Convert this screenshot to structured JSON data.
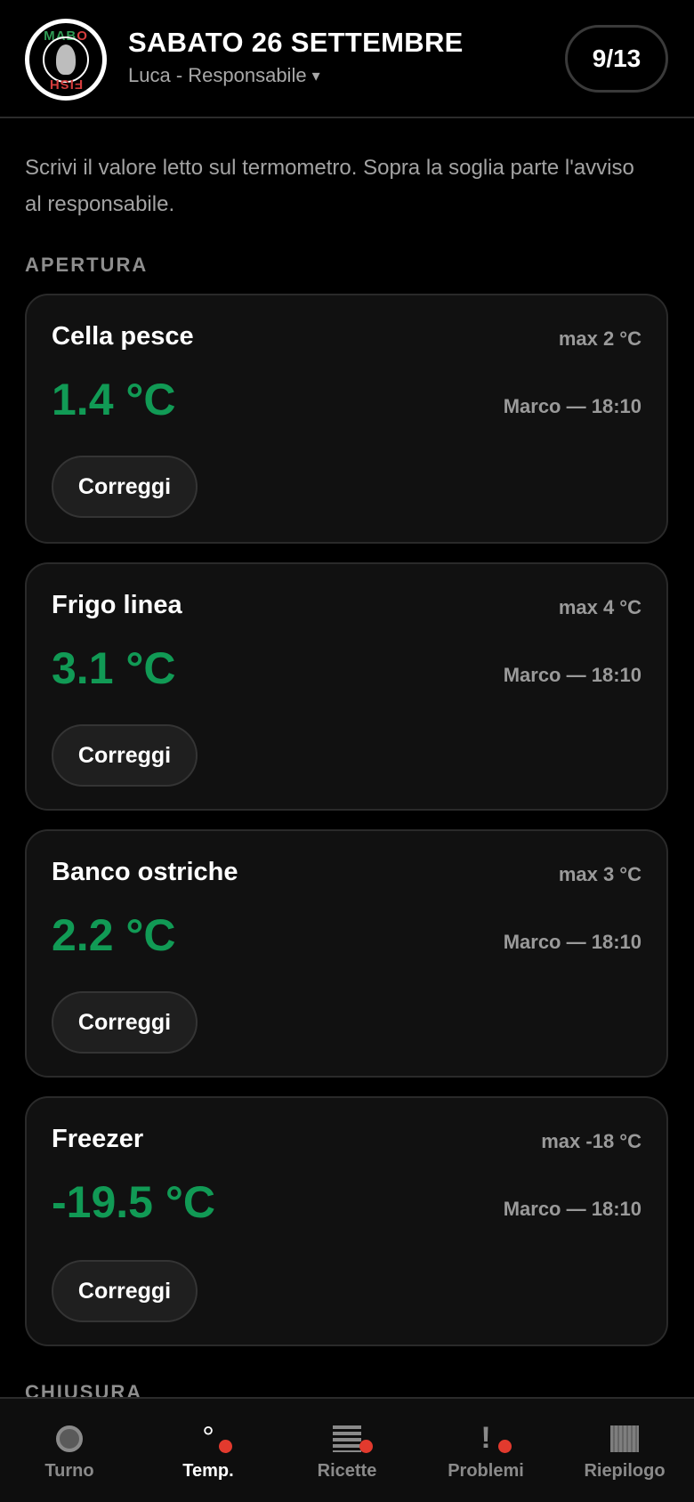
{
  "header": {
    "logo_text_top": "MABO",
    "logo_text_bottom": "FISH",
    "date": "SABATO 26 SETTEMBRE",
    "user": "Luca - Responsabile",
    "user_caret": "▾",
    "progress": "9/13"
  },
  "intro": "Scrivi il valore letto sul termometro. Sopra la soglia parte l'avviso al responsabile.",
  "sections": {
    "opening_label": "APERTURA",
    "closing_label": "CHIUSURA"
  },
  "cards": [
    {
      "name": "Cella pesce",
      "max": "max 2 °C",
      "value": "1.4 °C",
      "meta": "Marco — 18:10",
      "button": "Correggi"
    },
    {
      "name": "Frigo linea",
      "max": "max 4 °C",
      "value": "3.1 °C",
      "meta": "Marco — 18:10",
      "button": "Correggi"
    },
    {
      "name": "Banco ostriche",
      "max": "max 3 °C",
      "value": "2.2 °C",
      "meta": "Marco — 18:10",
      "button": "Correggi"
    },
    {
      "name": "Freezer",
      "max": "max -18 °C",
      "value": "-19.5 °C",
      "meta": "Marco — 18:10",
      "button": "Correggi"
    }
  ],
  "nav": [
    {
      "label": "Turno",
      "icon": "shift-icon",
      "glyph": "",
      "active": false,
      "dot": false
    },
    {
      "label": "Temp.",
      "icon": "degree-icon",
      "glyph": "°",
      "active": true,
      "dot": true
    },
    {
      "label": "Ricette",
      "icon": "list-icon",
      "glyph": "",
      "active": false,
      "dot": true
    },
    {
      "label": "Problemi",
      "icon": "exclamation-icon",
      "glyph": "!",
      "active": false,
      "dot": true
    },
    {
      "label": "Riepilogo",
      "icon": "grid-icon",
      "glyph": "",
      "active": false,
      "dot": false
    }
  ],
  "colors": {
    "value_ok": "#119a55",
    "alert_dot": "#e23a2e",
    "background": "#000000",
    "card": "#111111"
  }
}
